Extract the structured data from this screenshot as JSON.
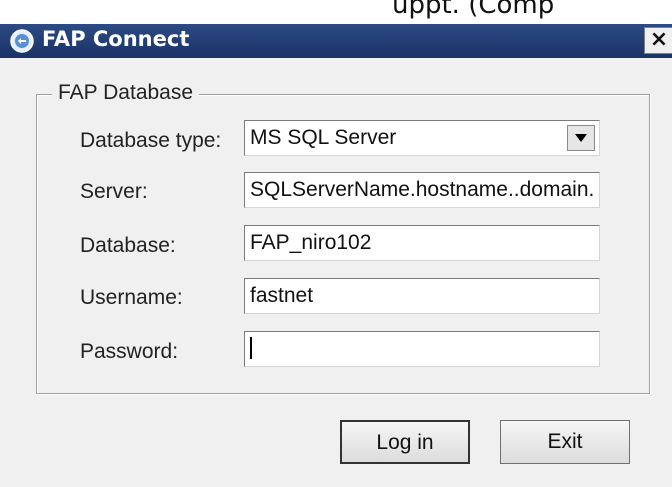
{
  "top_fragment": "uppt. (Comp",
  "window": {
    "title": "FAP Connect",
    "close_glyph": "×"
  },
  "group": {
    "label": "FAP Database"
  },
  "fields": {
    "database_type": {
      "label": "Database type:",
      "value": "MS SQL Server"
    },
    "server": {
      "label": "Server:",
      "value": "SQLServerName.hostname..domain."
    },
    "database": {
      "label": "Database:",
      "value": "FAP_niro102"
    },
    "username": {
      "label": "Username:",
      "value": "fastnet"
    },
    "password": {
      "label": "Password:",
      "value": ""
    }
  },
  "buttons": {
    "login": "Log in",
    "exit": "Exit"
  },
  "icons": {
    "app": "app-icon",
    "dropdown": "chevron-down-icon"
  },
  "colors": {
    "titlebar": "#1f3b73",
    "window_bg": "#f0f0f0"
  }
}
